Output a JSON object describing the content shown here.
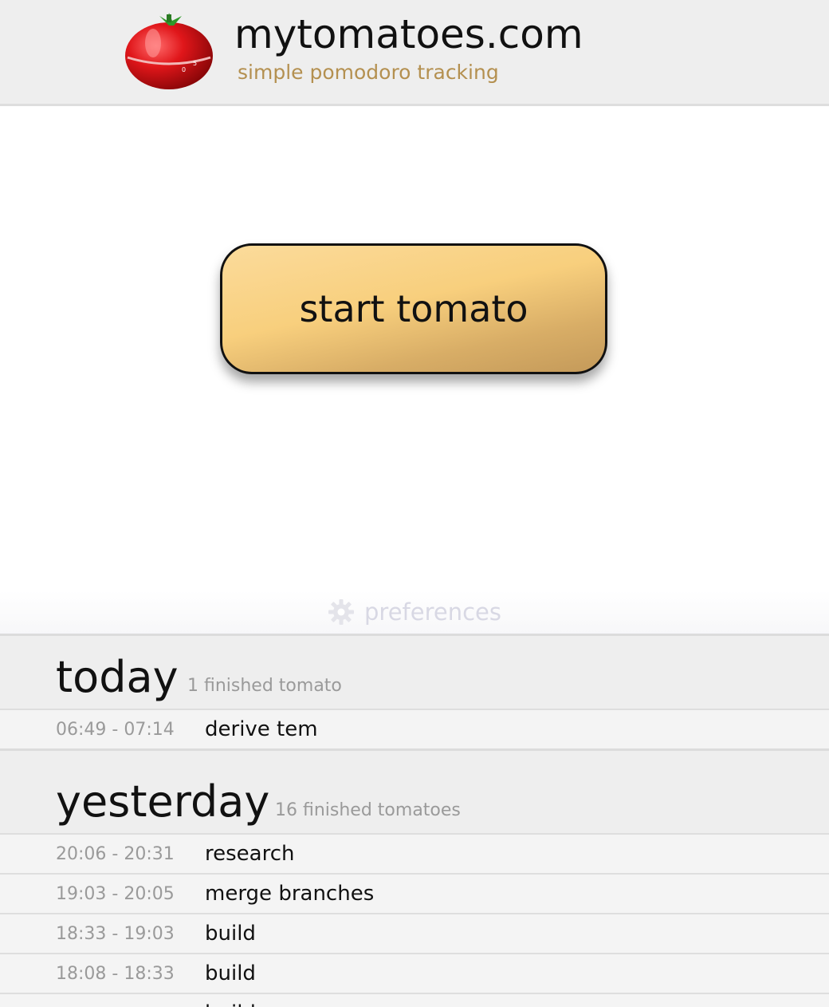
{
  "header": {
    "title": "mytomatoes.com",
    "tagline": "simple pomodoro tracking",
    "logo_icon": "tomato-timer-icon"
  },
  "main": {
    "start_button_label": "start tomato"
  },
  "preferences": {
    "label": "preferences",
    "icon": "gear-icon"
  },
  "today": {
    "title": "today",
    "count": "1 finished tomato",
    "rows": [
      {
        "time": "06:49 - 07:14",
        "task": "derive tem"
      }
    ]
  },
  "yesterday": {
    "title": "yesterday",
    "count": "16 finished tomatoes",
    "rows": [
      {
        "time": "20:06 - 20:31",
        "task": "research"
      },
      {
        "time": "19:03 - 20:05",
        "task": "merge branches"
      },
      {
        "time": "18:33 - 19:03",
        "task": "build"
      },
      {
        "time": "18:08 - 18:33",
        "task": "build"
      },
      {
        "time": "",
        "task": "build"
      }
    ]
  },
  "colors": {
    "header_bg": "#eeeeee",
    "tagline": "#b49050",
    "button_fill": "#f8cf7d",
    "muted_text": "#9a9a9a"
  }
}
